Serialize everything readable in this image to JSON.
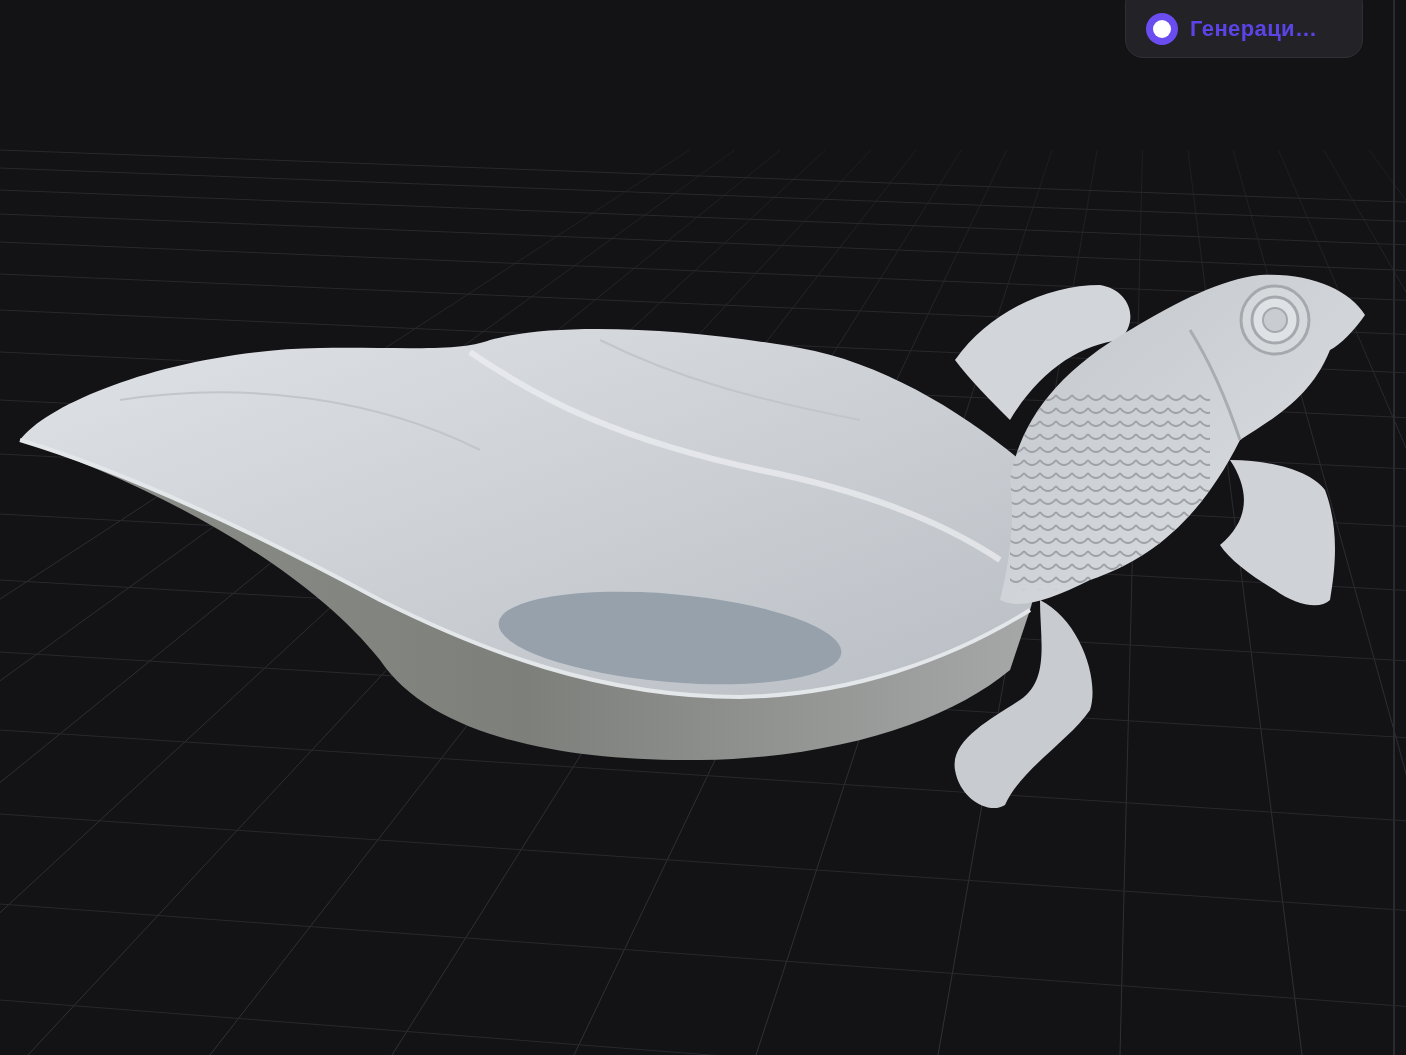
{
  "viewport": {
    "status_badge": {
      "label": "Генераци…"
    }
  }
}
